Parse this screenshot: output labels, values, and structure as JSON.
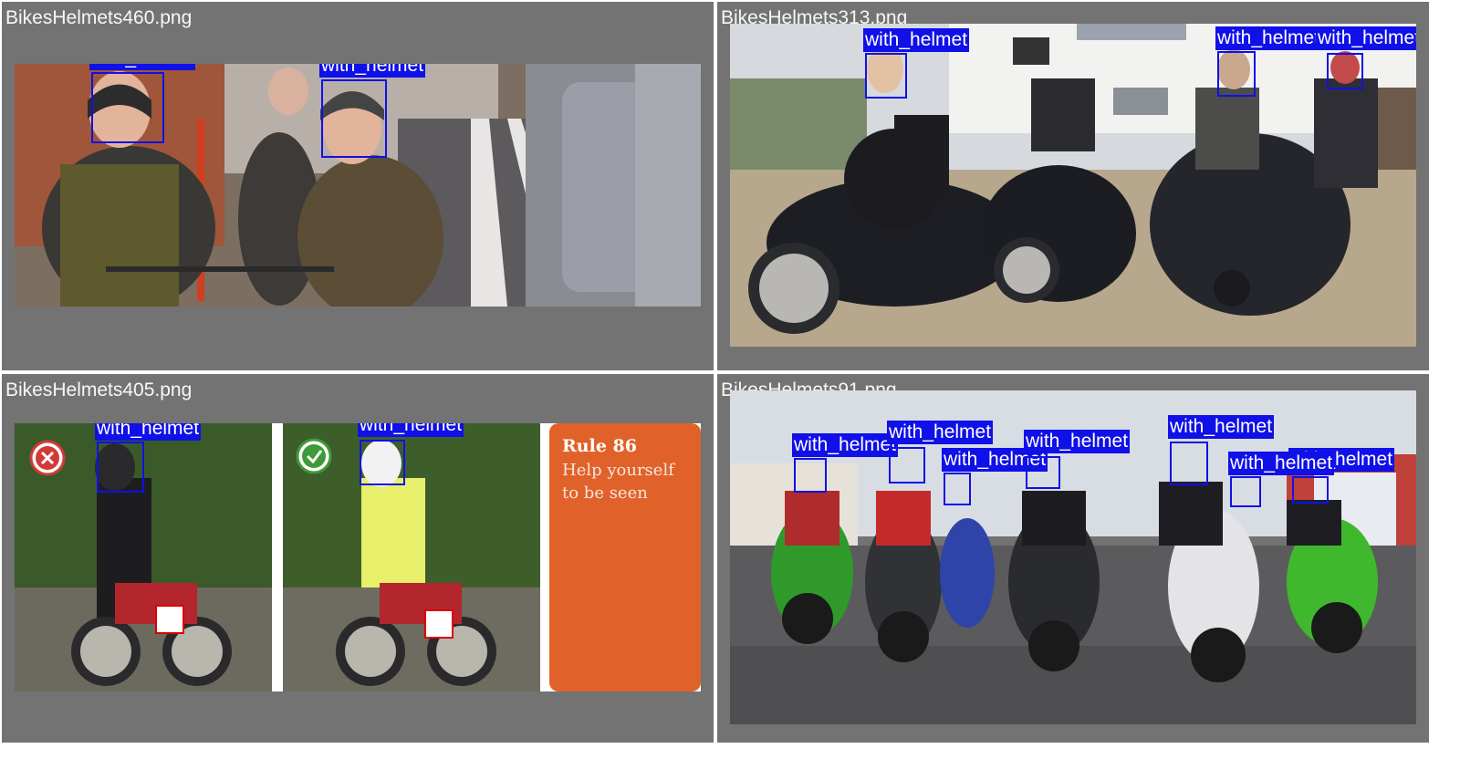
{
  "panels": [
    {
      "filename": "BikesHelmets460.png",
      "labels": [
        "with_helmet",
        "with_helmet"
      ]
    },
    {
      "filename": "BikesHelmets313.png",
      "labels": [
        "with_helmet",
        "with_helmet",
        "with_helmet"
      ]
    },
    {
      "filename": "BikesHelmets405.png",
      "labels": [
        "with_helmet",
        "with_helmet"
      ],
      "sign": {
        "title": "Rule 86",
        "line1": "Help yourself",
        "line2": "to be seen"
      }
    },
    {
      "filename": "BikesHelmets91.png",
      "labels": [
        "with_helmet",
        "with_helmet",
        "with_helmet",
        "with_helmet",
        "with_helmet",
        "with_helmet",
        "with_helmet"
      ]
    }
  ],
  "colors": {
    "panel_bg": "#737373",
    "box": "#1010e8",
    "label_text": "#ffffff",
    "sign_bg": "#e0622a"
  }
}
